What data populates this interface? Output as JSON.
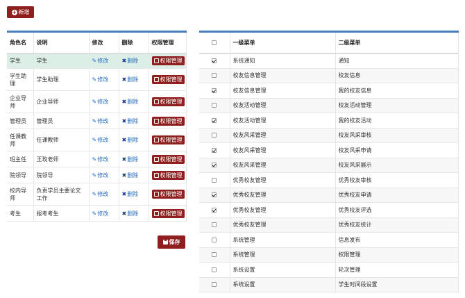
{
  "toolbar": {
    "add_label": "新增"
  },
  "roles_table": {
    "headers": {
      "name": "角色名",
      "desc": "说明",
      "edit": "修改",
      "delete": "删除",
      "perm": "权限管理"
    },
    "edit_label": "修改",
    "delete_label": "删除",
    "perm_label": "权限管理",
    "rows": [
      {
        "name": "学生",
        "desc": "学生",
        "selected": true
      },
      {
        "name": "学生助理",
        "desc": "学生助理"
      },
      {
        "name": "企业导师",
        "desc": "企业导师"
      },
      {
        "name": "管理员",
        "desc": "管理员"
      },
      {
        "name": "任课教师",
        "desc": "任课教师"
      },
      {
        "name": "班主任",
        "desc": "王玫老师"
      },
      {
        "name": "院领导",
        "desc": "院领导"
      },
      {
        "name": "校内导师",
        "desc": "负责学员主要论文工作"
      },
      {
        "name": "考生",
        "desc": "报考考生"
      }
    ]
  },
  "save_label": "保存",
  "menu_table": {
    "headers": {
      "level1": "一级菜单",
      "level2": "二级菜单"
    },
    "header_checked": false,
    "rows": [
      {
        "checked": true,
        "level1": "系统通知",
        "level2": "通知"
      },
      {
        "checked": false,
        "level1": "校友信息管理",
        "level2": "校友信息"
      },
      {
        "checked": true,
        "level1": "校友信息管理",
        "level2": "我的校友信息"
      },
      {
        "checked": false,
        "level1": "校友活动管理",
        "level2": "校友活动管理"
      },
      {
        "checked": true,
        "level1": "校友活动管理",
        "level2": "我的校友活动"
      },
      {
        "checked": false,
        "level1": "校友风采管理",
        "level2": "校友风采审核"
      },
      {
        "checked": true,
        "level1": "校友风采管理",
        "level2": "校友风采申请"
      },
      {
        "checked": true,
        "level1": "校友风采管理",
        "level2": "校友风采展示"
      },
      {
        "checked": false,
        "level1": "优秀校友管理",
        "level2": "优秀校友审核"
      },
      {
        "checked": true,
        "level1": "优秀校友管理",
        "level2": "优秀校友申请"
      },
      {
        "checked": true,
        "level1": "优秀校友管理",
        "level2": "优秀校友评选"
      },
      {
        "checked": false,
        "level1": "优秀校友管理",
        "level2": "优秀校友统计"
      },
      {
        "checked": false,
        "level1": "系统管理",
        "level2": "信息发布"
      },
      {
        "checked": false,
        "level1": "系统管理",
        "level2": "权限管理"
      },
      {
        "checked": false,
        "level1": "系统设置",
        "level2": "轮次管理"
      },
      {
        "checked": false,
        "level1": "系统设置",
        "level2": "学生时间段设置"
      }
    ]
  },
  "colors": {
    "accent": "#8f1e1e",
    "header_bar": "#4a7ebb",
    "selected_row": "#dcefe6"
  }
}
